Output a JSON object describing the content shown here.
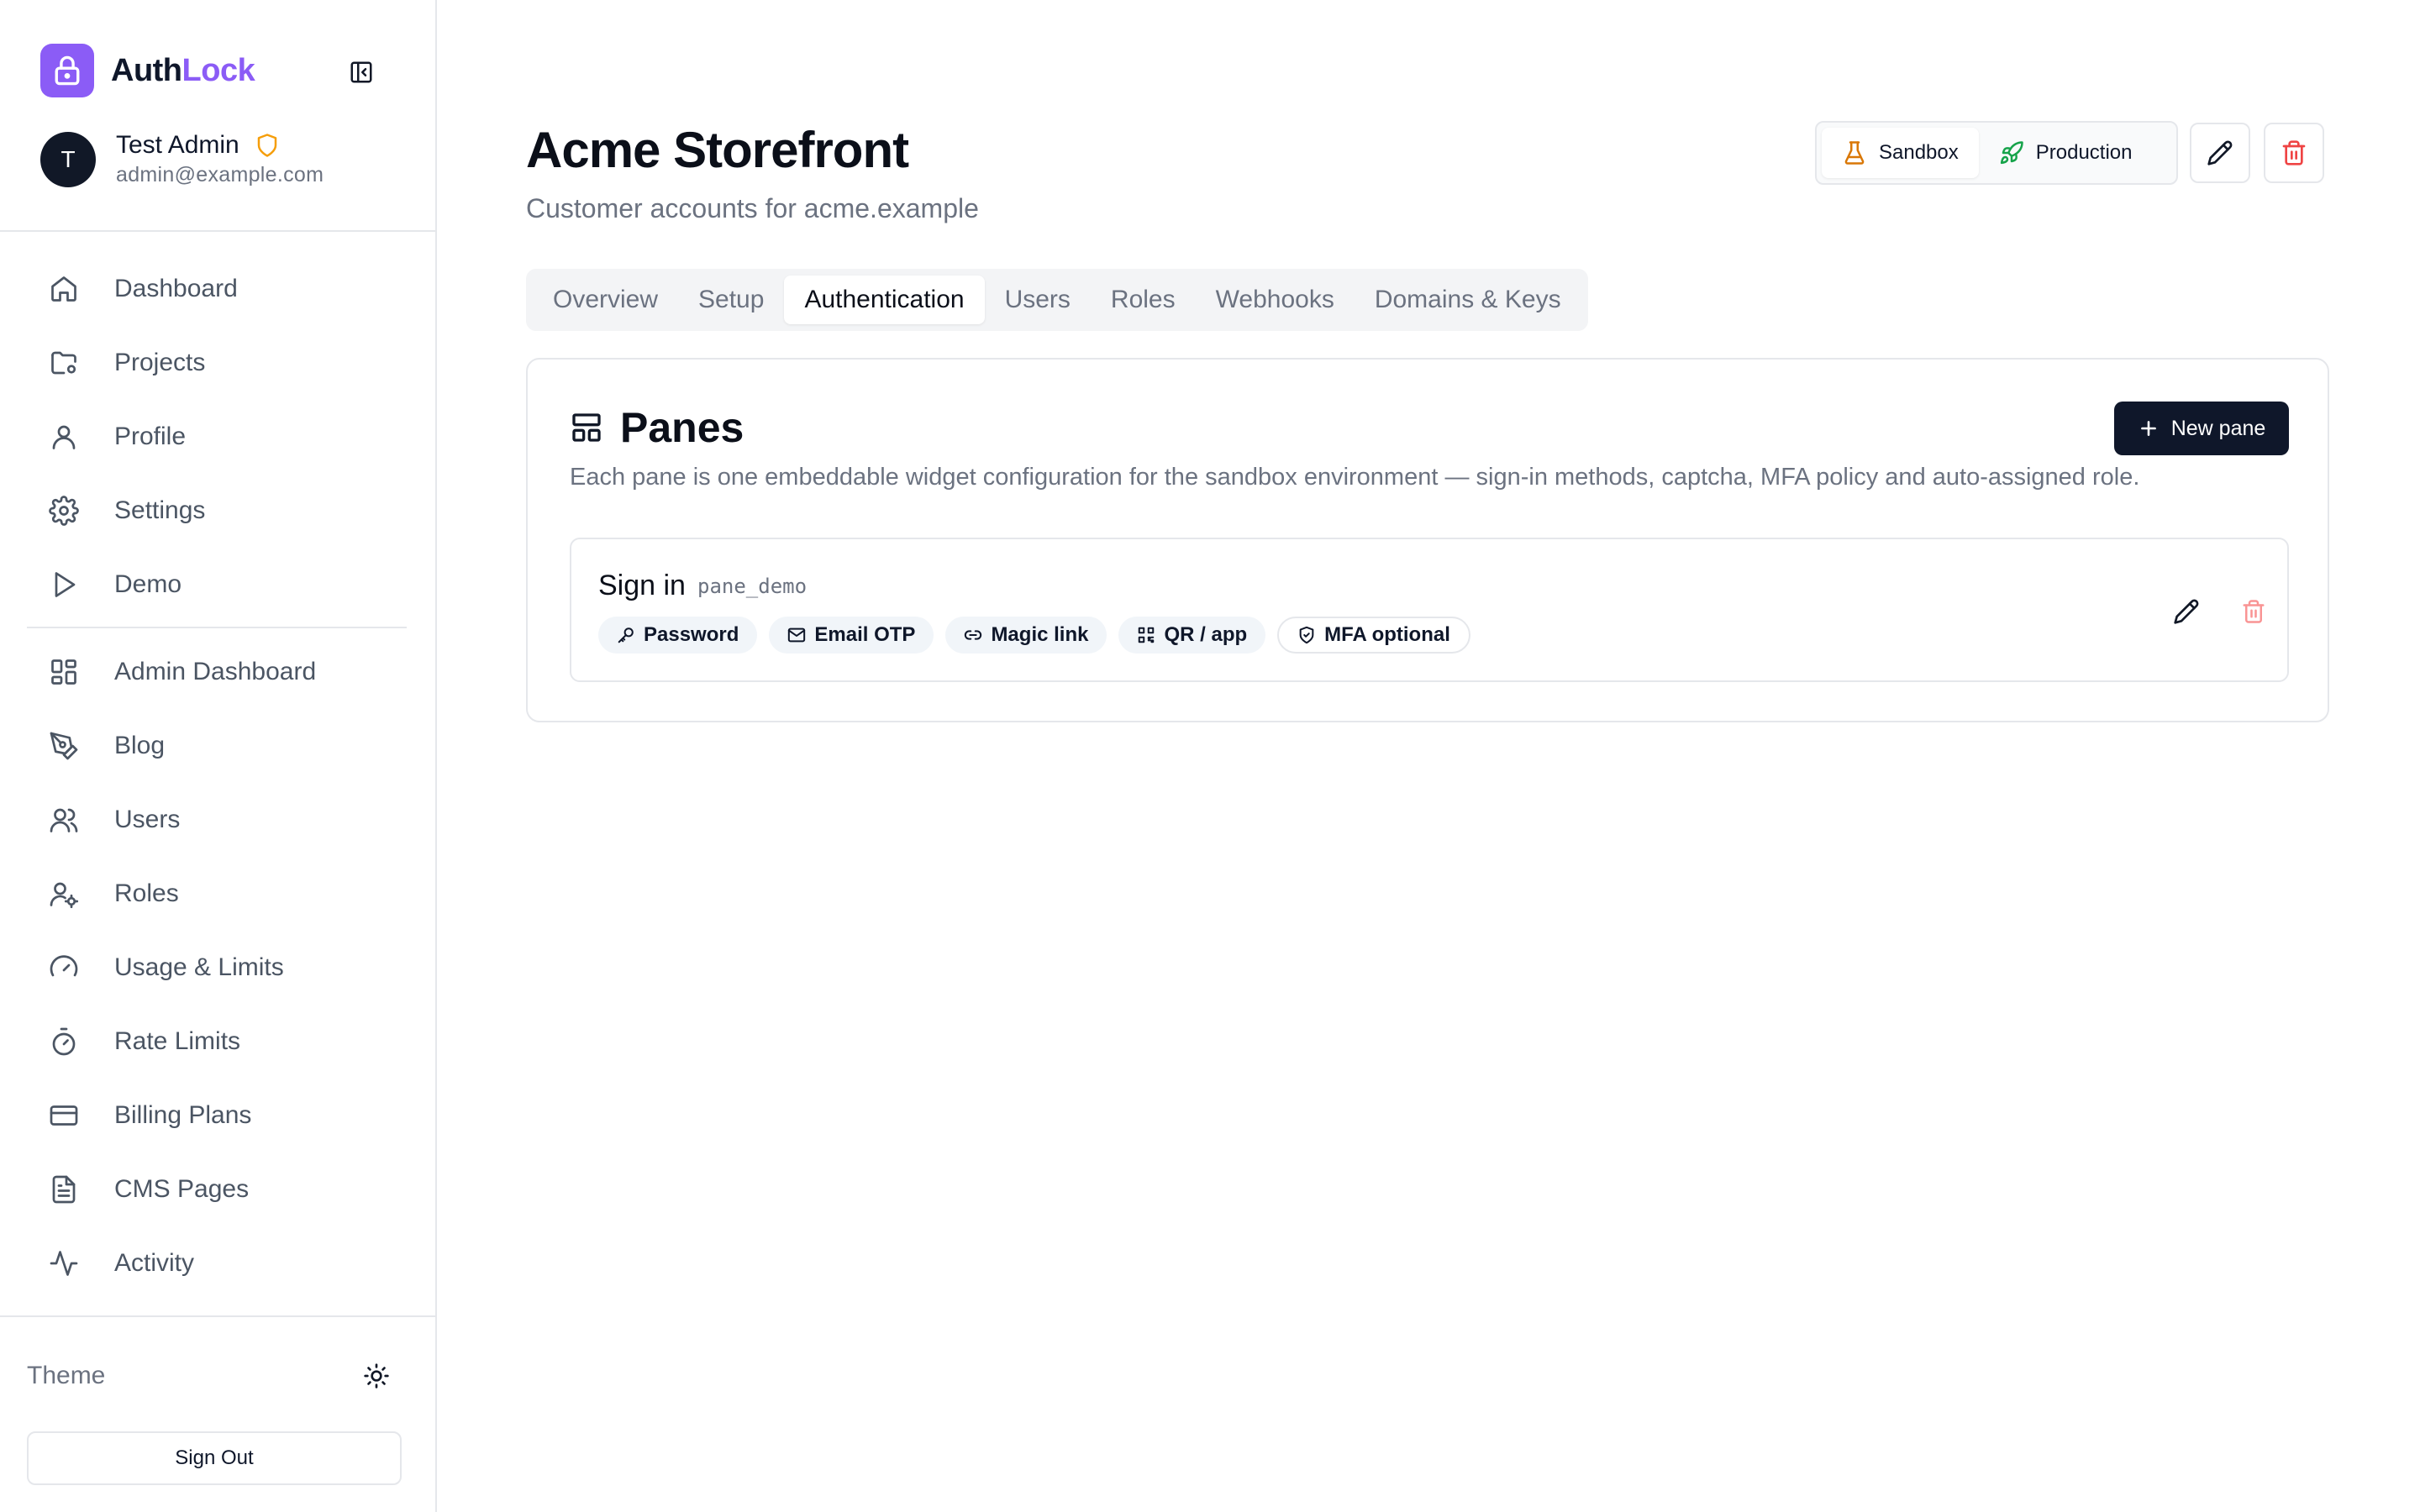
{
  "brand": {
    "name_prefix": "Auth",
    "name_accent": "Lock"
  },
  "user": {
    "initial": "T",
    "name": "Test Admin",
    "email": "admin@example.com"
  },
  "nav_primary": [
    {
      "label": "Dashboard",
      "icon": "home-icon"
    },
    {
      "label": "Projects",
      "icon": "folder-icon"
    },
    {
      "label": "Profile",
      "icon": "user-icon"
    },
    {
      "label": "Settings",
      "icon": "gear-icon"
    },
    {
      "label": "Demo",
      "icon": "play-icon"
    }
  ],
  "nav_admin": [
    {
      "label": "Admin Dashboard",
      "icon": "grid-icon"
    },
    {
      "label": "Blog",
      "icon": "pen-tool-icon"
    },
    {
      "label": "Users",
      "icon": "users-icon"
    },
    {
      "label": "Roles",
      "icon": "user-cog-icon"
    },
    {
      "label": "Usage & Limits",
      "icon": "gauge-icon"
    },
    {
      "label": "Rate Limits",
      "icon": "timer-icon"
    },
    {
      "label": "Billing Plans",
      "icon": "credit-card-icon"
    },
    {
      "label": "CMS Pages",
      "icon": "file-text-icon"
    },
    {
      "label": "Activity",
      "icon": "activity-icon"
    }
  ],
  "footer": {
    "theme_label": "Theme",
    "sign_out": "Sign Out"
  },
  "project": {
    "title": "Acme Storefront",
    "subtitle": "Customer accounts for acme.example"
  },
  "environments": {
    "sandbox": "Sandbox",
    "production": "Production",
    "active": "Sandbox"
  },
  "tabs": [
    "Overview",
    "Setup",
    "Authentication",
    "Users",
    "Roles",
    "Webhooks",
    "Domains & Keys"
  ],
  "active_tab": "Authentication",
  "panes": {
    "title": "Panes",
    "description": "Each pane is one embeddable widget configuration for the sandbox environment — sign-in methods, captcha, MFA policy and auto-assigned role.",
    "new_button": "New pane",
    "items": [
      {
        "name": "Sign in",
        "id": "pane_demo",
        "methods": [
          {
            "label": "Password",
            "icon": "key-icon"
          },
          {
            "label": "Email OTP",
            "icon": "mail-icon"
          },
          {
            "label": "Magic link",
            "icon": "link-icon"
          },
          {
            "label": "QR / app",
            "icon": "qr-code-icon"
          }
        ],
        "mfa": {
          "label": "MFA optional",
          "icon": "shield-check-icon"
        }
      }
    ]
  },
  "colors": {
    "accent": "#8b5cf6",
    "primary_dark": "#0f172a",
    "danger": "#ef4444",
    "warning": "#f59e0b",
    "success": "#16a34a"
  }
}
